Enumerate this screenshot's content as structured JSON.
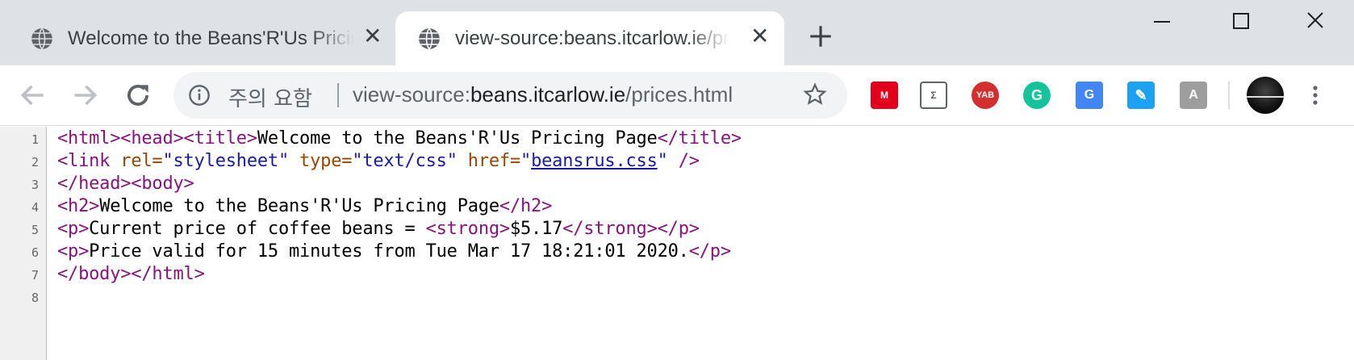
{
  "tabs": [
    {
      "title": "Welcome to the Beans'R'Us Pricing Page",
      "active": false,
      "close": "✕"
    },
    {
      "title": "view-source:beans.itcarlow.ie/prices.html",
      "active": true,
      "close": "✕"
    }
  ],
  "new_tab_icon": "plus-icon",
  "omnibox": {
    "security_label": "주의 요함",
    "url_prefix": "view-source:",
    "url_host": "beans.itcarlow.ie",
    "url_path": "/prices.html"
  },
  "extensions": [
    {
      "name": "mendeley-extension",
      "label": "M",
      "color": "#e3001b"
    },
    {
      "name": "sigma-extension",
      "label": "Σ",
      "color": "#ffffff"
    },
    {
      "name": "yab-extension",
      "label": "YAB",
      "color": "#d32f2f"
    },
    {
      "name": "grammarly-extension",
      "label": "G",
      "color": "#15c39a"
    },
    {
      "name": "google-translate-extension",
      "label": "G",
      "color": "#4285f4"
    },
    {
      "name": "pen-extension",
      "label": "✎",
      "color": "#1da1f2"
    },
    {
      "name": "pdf-extension",
      "label": "A",
      "color": "#9e9e9e"
    }
  ],
  "source": {
    "line_numbers": [
      "1",
      "2",
      "3",
      "4",
      "5",
      "6",
      "7",
      "8"
    ],
    "line1": {
      "t1": "<html><head><title>",
      "text": "Welcome to the Beans'R'Us Pricing Page",
      "t2": "</title>"
    },
    "line2": {
      "t1": "<link ",
      "a1": "rel=",
      "v1": "\"stylesheet\"",
      "a2": " type=",
      "v2": "\"text/css\"",
      "a3": " href=",
      "q1": "\"",
      "href": "beansrus.css",
      "q2": "\"",
      "t2": " />"
    },
    "line3": {
      "t1": "</head><body>"
    },
    "line4": {
      "t1": "<h2>",
      "text": "Welcome to the Beans'R'Us Pricing Page",
      "t2": "</h2>"
    },
    "line5": {
      "t1": "<p>",
      "text1": "Current price of coffee beans = ",
      "t2": "<strong>",
      "text2": "$5.17",
      "t3": "</strong></p>"
    },
    "line6": {
      "t1": "<p>",
      "text": "Price valid for 15 minutes from Tue Mar 17 18:21:01 2020.",
      "t2": "</p>"
    },
    "line7": {
      "t1": "</body></html>"
    }
  }
}
